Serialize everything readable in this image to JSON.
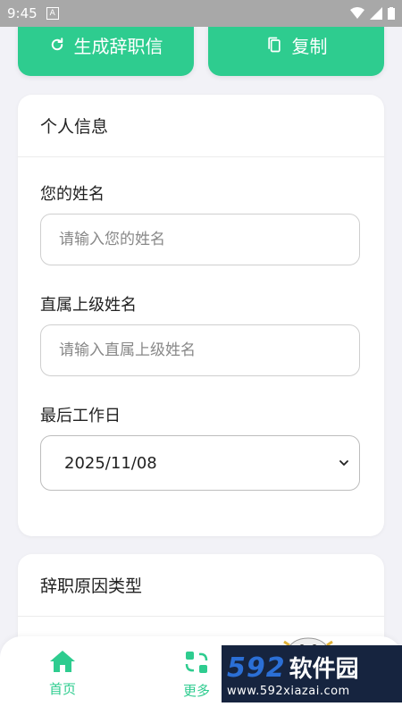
{
  "status_bar": {
    "time": "9:45",
    "notif_letter": "A"
  },
  "top_actions": {
    "generate_label": "生成辞职信",
    "copy_label": "复制"
  },
  "personal_info": {
    "title": "个人信息",
    "name_label": "您的姓名",
    "name_placeholder": "请输入您的姓名",
    "name_value": "",
    "manager_label": "直属上级姓名",
    "manager_placeholder": "请输入直属上级姓名",
    "manager_value": "",
    "last_day_label": "最后工作日",
    "last_day_value": "2025/11/08"
  },
  "reason_card": {
    "title": "辞职原因类型"
  },
  "bottom_nav": {
    "home_label": "首页",
    "more_label": "更多"
  },
  "watermark": {
    "number": "592",
    "brand": "软件园",
    "url": "www.592xiazai.com"
  },
  "colors": {
    "accent": "#2ecc8f",
    "background": "#f2f2f7",
    "statusbar": "#a8a8a8"
  },
  "icons": {
    "generate": "refresh-icon",
    "copy": "copy-icon",
    "select": "chevron-down-icon",
    "home": "home-icon",
    "more": "grid-swap-icon"
  }
}
